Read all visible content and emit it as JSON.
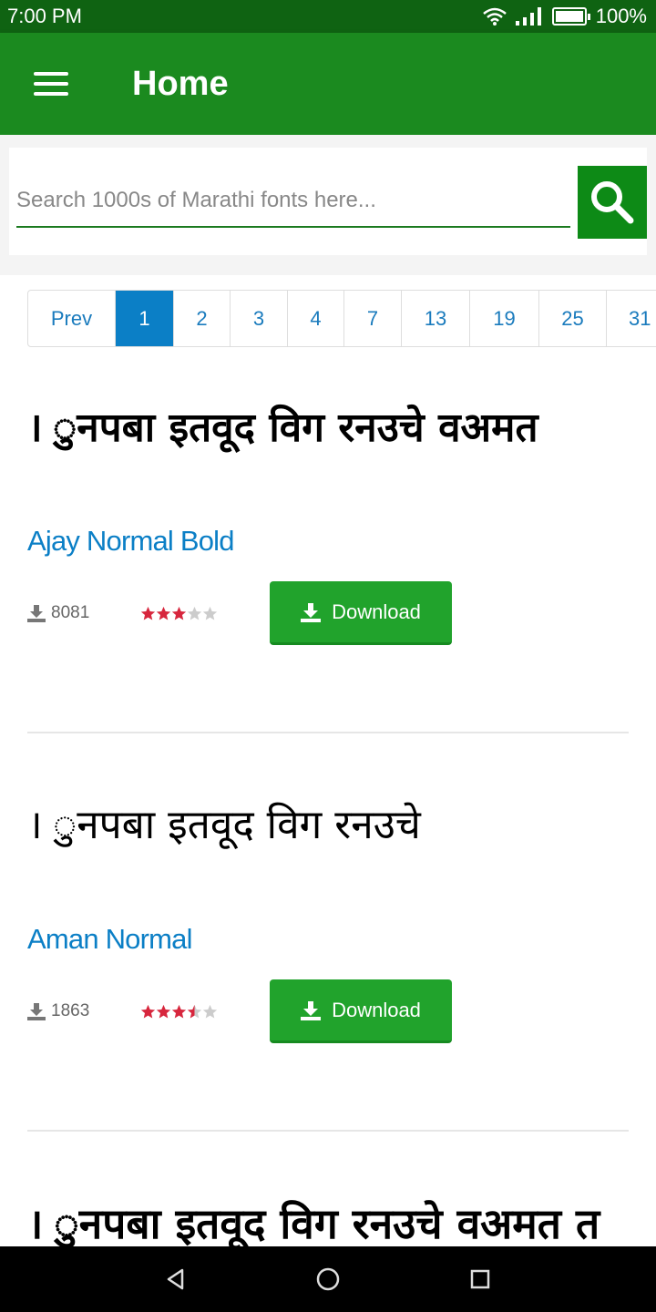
{
  "status_bar": {
    "time": "7:00 PM",
    "battery": "100%",
    "battery_level": 1.0
  },
  "app_bar": {
    "title": "Home",
    "menu_icon": "hamburger-menu-icon"
  },
  "search": {
    "placeholder": "Search 1000s of Marathi fonts here...",
    "value": "",
    "button_icon": "search-icon"
  },
  "pagination": {
    "prev": "Prev",
    "pages": [
      "1",
      "2",
      "3",
      "4",
      "7",
      "13",
      "19",
      "25",
      "31"
    ],
    "active": "1"
  },
  "fonts": [
    {
      "preview": "। ुनपबा  इतवूद  विग  रनउचे  वअमत",
      "name": "Ajay Normal Bold",
      "downloads": "8081",
      "rating": 3.0,
      "button_label": "Download"
    },
    {
      "preview": "। ुनपबा  इतवूद  विग  रनउचे",
      "name": "Aman Normal",
      "downloads": "1863",
      "rating": 3.5,
      "button_label": "Download"
    },
    {
      "preview": "। ुनपबा इतवूद विग रनउचे वअमत त",
      "name": "",
      "downloads": "",
      "rating": null,
      "button_label": ""
    }
  ],
  "colors": {
    "status_bar": "#0f6312",
    "app_bar": "#1b8a1f",
    "accent_blue": "#0b7fc6",
    "download_green": "#21a32c",
    "star_red": "#d7263d",
    "star_grey": "#cccccc"
  },
  "nav_bar": {
    "icons": [
      "back-icon",
      "home-icon",
      "recents-icon"
    ]
  }
}
